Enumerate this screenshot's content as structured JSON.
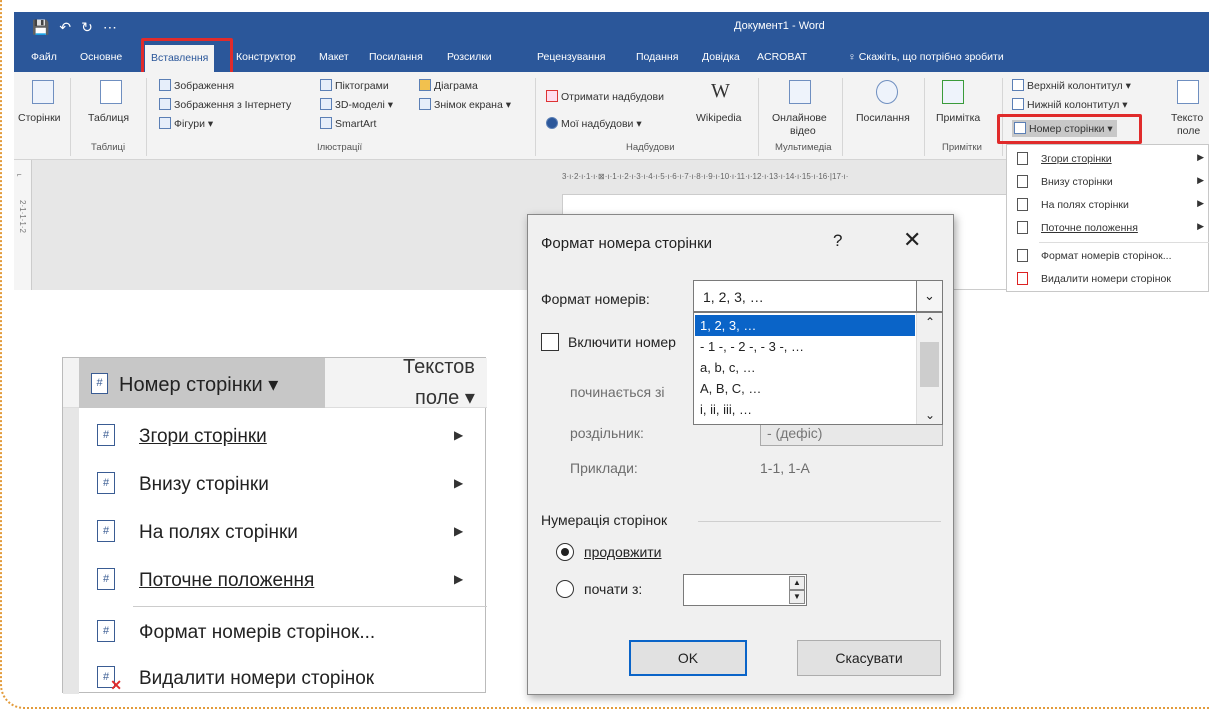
{
  "window": {
    "title": "Документ1  -  Word",
    "qat": [
      "💾",
      "↶",
      "↻",
      "⋯"
    ]
  },
  "tabs": [
    "Файл",
    "Основне",
    "Вставлення",
    "Конструктор",
    "Макет",
    "Посилання",
    "Розсилки",
    "Рецензування",
    "Подання",
    "Довідка",
    "ACROBAT"
  ],
  "tell_me": "Скажіть, що потрібно зробити",
  "ribbon": {
    "pages": "Сторінки",
    "table": "Таблиця",
    "tables_group": "Таблиці",
    "pictures": "Зображення",
    "online_pictures": "Зображення з Інтернету",
    "shapes": "Фігури",
    "icons": "Піктограми",
    "models3d": "3D-моделі",
    "smartart": "SmartArt",
    "chart": "Діаграма",
    "screenshot": "Знімок екрана",
    "illustrations_group": "Ілюстрації",
    "get_addins": "Отримати надбудови",
    "my_addins": "Мої надбудови",
    "wikipedia": "Wikipedia",
    "wiki_glyph": "W",
    "addins_group": "Надбудови",
    "online_video_1": "Онлайнове",
    "online_video_2": "відео",
    "media_group": "Мультимедіа",
    "links": "Посилання",
    "comment": "Примітка",
    "comments_group": "Примітки",
    "header": "Верхній колонтитул",
    "footer": "Нижній колонтитул",
    "page_number": "Номер сторінки",
    "textbox_1": "Тексто",
    "textbox_2": "поле"
  },
  "ruler": "3·ı·2·ı·1·ı·⊠·ı·1·ı·2·ı·3·ı·4·ı·5·ı·6·ı·7·ı·8·ı·9·ı·10·ı·11·ı·12·ı·13·ı·14·ı·15·ı·16·|17·ı·",
  "left_ruler": "2·1·1·1·2",
  "page_number_menu": [
    {
      "label": "Згори сторінки",
      "submenu": true,
      "icon": "page-top-icon"
    },
    {
      "label": "Внизу сторінки",
      "submenu": true,
      "icon": "page-bottom-icon"
    },
    {
      "label": "На полях сторінки",
      "submenu": true,
      "icon": "page-margins-icon"
    },
    {
      "label": "Поточне положення",
      "submenu": true,
      "icon": "current-position-icon"
    },
    {
      "label": "Формат номерів сторінок...",
      "submenu": false,
      "icon": "format-numbers-icon"
    },
    {
      "label": "Видалити номери сторінок",
      "submenu": false,
      "icon": "remove-numbers-icon"
    }
  ],
  "dialog": {
    "title": "Формат номера сторінки",
    "help": "?",
    "close": "✕",
    "format_label": "Формат номерів:",
    "format_value": "1, 2, 3, …",
    "format_options": [
      "1, 2, 3, …",
      "- 1 -, - 2 -, - 3 -, …",
      "a, b, c, …",
      "A, B, C, …",
      "i, ii, iii, …"
    ],
    "include_chapter": "Включити номер",
    "starts_with": "починається зі",
    "separator_label": "роздільник:",
    "separator_value": "-    (дефіс)",
    "examples_label": "Приклади:",
    "examples_value": "1-1, 1-А",
    "numbering_group": "Нумерація сторінок",
    "continue": "продовжити",
    "start_at": "почати з:",
    "start_at_value": "",
    "ok": "OK",
    "cancel": "Скасувати"
  },
  "zoom": {
    "button": "Номер сторінки ▾",
    "textbox_1": "Текстов",
    "textbox_2": "поле ▾"
  }
}
